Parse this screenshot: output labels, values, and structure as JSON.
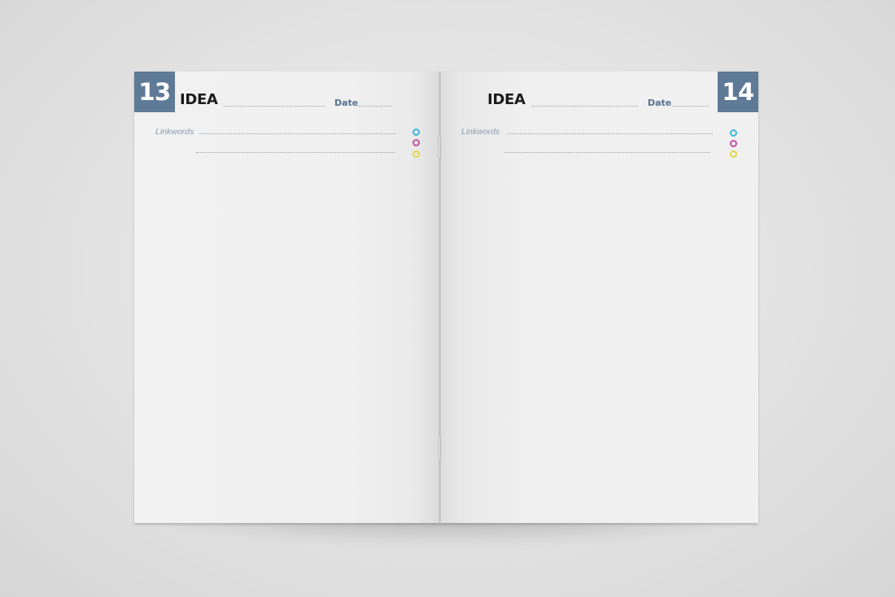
{
  "pages": {
    "left": {
      "number": "13",
      "title": "IDEA",
      "date_label": "Date",
      "linkwords_label": "Linkwords"
    },
    "right": {
      "number": "14",
      "title": "IDEA",
      "date_label": "Date",
      "linkwords_label": "Linkwords"
    }
  },
  "colors": {
    "number_box": "#5f7a97",
    "date_text": "#56708f",
    "circle_cyan": "#3cb6da",
    "circle_magenta": "#c3509f",
    "circle_yellow": "#e3d74a"
  }
}
